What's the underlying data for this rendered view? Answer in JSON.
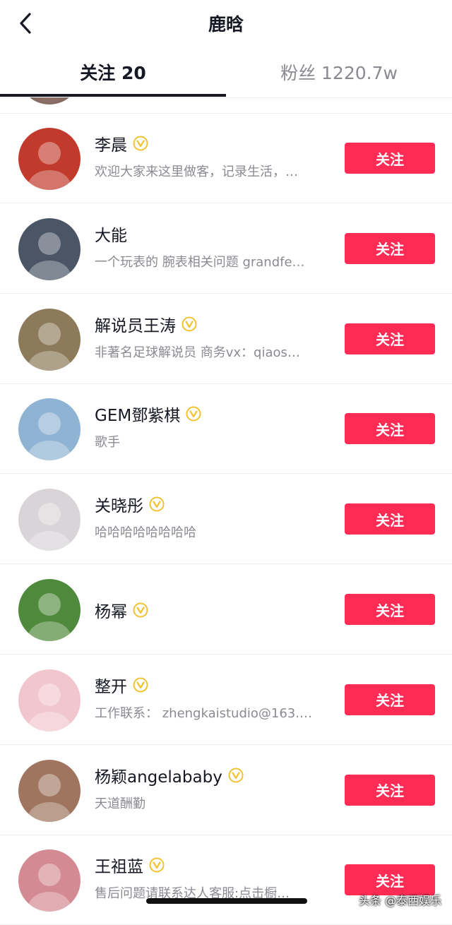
{
  "header": {
    "title": "鹿晗"
  },
  "tabs": [
    {
      "label": "关注 20"
    },
    {
      "label": "粉丝 1220.7w"
    }
  ],
  "follow_label": "关注",
  "brand_color": "#fe2c55",
  "verified_color": "#f1c232",
  "users": [
    {
      "name": "李晨",
      "verified": true,
      "desc": "欢迎大家来这里做客，记录生活，…",
      "avatar_bg": "#c23a2c"
    },
    {
      "name": "大能",
      "verified": false,
      "desc": "一个玩表的 腕表相关问题 grandfe…",
      "avatar_bg": "#4a5566"
    },
    {
      "name": "解说员王涛",
      "verified": true,
      "desc": "非著名足球解说员 商务vx：qiaos…",
      "avatar_bg": "#8c7a5a"
    },
    {
      "name": "GEM鄧紫棋",
      "verified": true,
      "desc": "歌手",
      "avatar_bg": "#8fb3d3"
    },
    {
      "name": "关晓彤",
      "verified": true,
      "desc": "哈哈哈哈哈哈哈哈",
      "avatar_bg": "#d9d4d8"
    },
    {
      "name": "杨幂",
      "verified": true,
      "desc": "",
      "avatar_bg": "#4f8a3c"
    },
    {
      "name": "整开",
      "verified": true,
      "desc": "工作联系： zhengkaistudio@163.…",
      "avatar_bg": "#f2c6cf"
    },
    {
      "name": "杨颖angelababy",
      "verified": true,
      "desc": "天道酬勤",
      "avatar_bg": "#a0755f"
    },
    {
      "name": "王祖蓝",
      "verified": true,
      "desc": "售后问题请联系达人客服:点击橱…",
      "avatar_bg": "#d48a93"
    }
  ],
  "watermark": "头条 @泰西娱乐"
}
